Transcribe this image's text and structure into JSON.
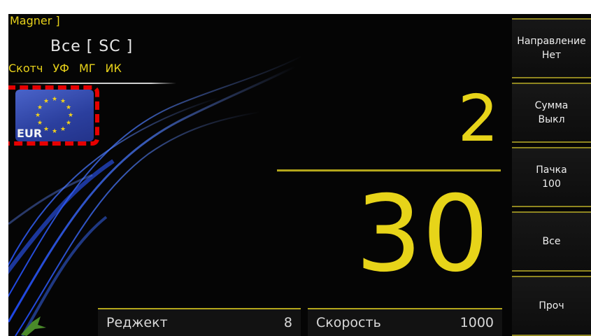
{
  "header": {
    "brand": "Magner ]",
    "mode": "Все [ SC ]",
    "sensors": [
      "Скотч",
      "УФ",
      "МГ",
      "ИК"
    ]
  },
  "currency": {
    "code": "EUR",
    "icon": "eu-flag-icon",
    "highlight_color": "#e60000"
  },
  "counters": {
    "count": "2",
    "total": "30"
  },
  "bottom": {
    "reject_label": "Реджект",
    "reject_value": "8",
    "speed_label": "Скорость",
    "speed_value": "1000"
  },
  "menu": [
    {
      "line1": "Направление",
      "line2": "Нет"
    },
    {
      "line1": "Сумма",
      "line2": "Выкл"
    },
    {
      "line1": "Пачка",
      "line2": "100"
    },
    {
      "line1": "Все",
      "line2": ""
    },
    {
      "line1": "Проч",
      "line2": ""
    }
  ],
  "colors": {
    "accent_yellow": "#e7d419",
    "background": "#050505",
    "swirl_blue": "#2f64ff"
  }
}
